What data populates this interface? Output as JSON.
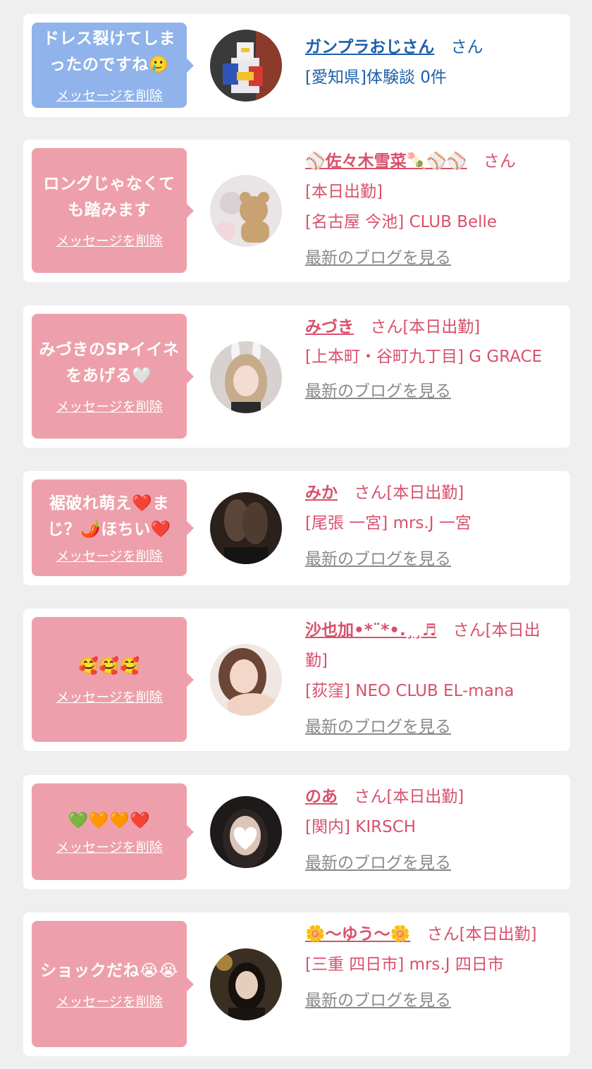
{
  "cards": [
    {
      "theme": "blue",
      "message": "ドレス裂けてしまったのですね🥲",
      "delete_label": "メッセージを削除",
      "name": "ガンプラおじさん",
      "honorific": "さん",
      "status": "",
      "lines": [
        "[愛知県]体験談 0件"
      ],
      "blog_label": "",
      "avatar_icon": "gundam-figure-photo"
    },
    {
      "theme": "pink",
      "message": "ロングじゃなくても踏みます",
      "delete_label": "メッセージを削除",
      "name": "⚾佐々木雪菜🍡⚾⚾",
      "honorific": "さん",
      "status": "",
      "lines": [
        "[本日出勤]",
        "[名古屋 今池] CLUB Belle"
      ],
      "blog_label": "最新のブログを見る",
      "avatar_icon": "teddy-bear-photo"
    },
    {
      "theme": "pink",
      "message": "みづきのSPイイネをあげる🤍",
      "delete_label": "メッセージを削除",
      "name": "みづき",
      "honorific": "さん[本日出勤]",
      "status": "",
      "lines": [
        "[上本町・谷町九丁目] G GRACE"
      ],
      "blog_label": "最新のブログを見る",
      "avatar_icon": "bunny-ears-photo"
    },
    {
      "theme": "pink",
      "message": "裾破れ萌え❤️まじ？🌶️ほちい❤️",
      "delete_label": "メッセージを削除",
      "name": "みか",
      "honorific": "さん[本日出勤]",
      "status": "",
      "lines": [
        "[尾張 一宮] mrs.J 一宮"
      ],
      "blog_label": "最新のブログを見る",
      "avatar_icon": "legs-photo"
    },
    {
      "theme": "pink",
      "message": "🥰🥰🥰",
      "delete_label": "メッセージを削除",
      "name": "沙也加•*¨*•.¸¸♬",
      "honorific": "さん[本日出勤]",
      "status": "",
      "lines": [
        "[荻窪] NEO CLUB EL-mana"
      ],
      "blog_label": "最新のブログを見る",
      "avatar_icon": "portrait-photo"
    },
    {
      "theme": "pink",
      "message": "💚🧡🧡❤️",
      "delete_label": "メッセージを削除",
      "name": "のあ",
      "honorific": "さん[本日出勤]",
      "status": "",
      "lines": [
        "[関内] KIRSCH"
      ],
      "blog_label": "最新のブログを見る",
      "avatar_icon": "heart-covered-face-photo"
    },
    {
      "theme": "pink",
      "message": "ショックだね😭😭",
      "delete_label": "メッセージを削除",
      "name": "🌼〜ゆう〜🌼",
      "honorific": "さん[本日出勤]",
      "status": "",
      "lines": [
        "[三重 四日市] mrs.J 四日市"
      ],
      "blog_label": "最新のブログを見る",
      "avatar_icon": "dark-portrait-photo"
    }
  ]
}
